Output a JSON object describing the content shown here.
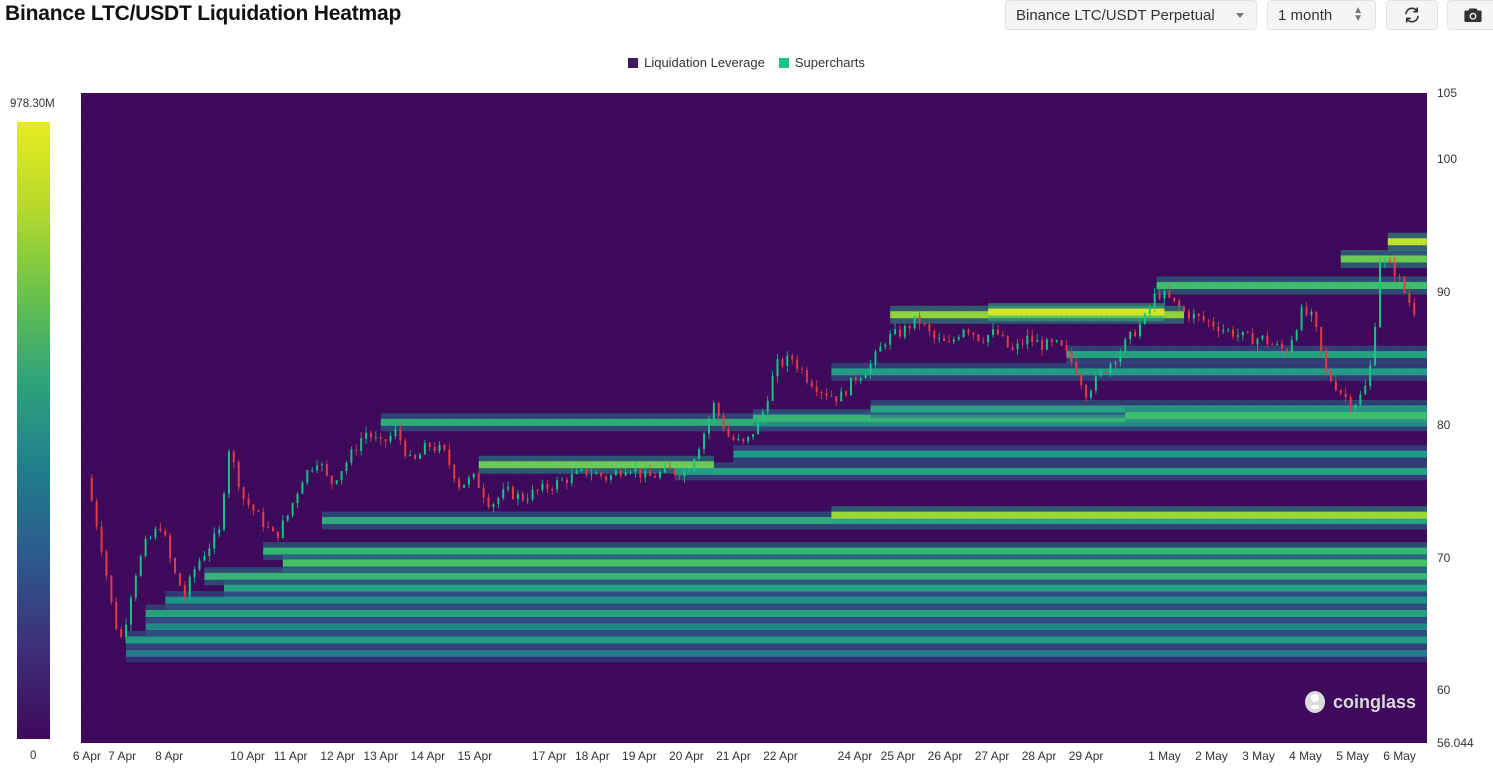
{
  "header": {
    "title": "Binance LTC/USDT Liquidation Heatmap",
    "exchange_select": "Binance LTC/USDT Perpetual",
    "period_select": "1 month"
  },
  "icons": {
    "refresh": "refresh-icon",
    "camera": "camera-icon",
    "watermark": "coinglass-logo-icon"
  },
  "watermark": "coinglass",
  "colorbar": {
    "max_label": "978.30M",
    "min_label": "0",
    "colors": [
      "#3e0a5b",
      "#2c5b8e",
      "#1f9a8a",
      "#3fbf6f",
      "#9ad93a",
      "#e7ec1e"
    ]
  },
  "chart_data": {
    "type": "heatmap",
    "title": "Binance LTC/USDT Liquidation Heatmap",
    "legend": [
      {
        "name": "Liquidation Leverage",
        "color": "#3e1a60"
      },
      {
        "name": "Supercharts",
        "color": "#16c784"
      }
    ],
    "legend_position": "top-center",
    "x_labels": [
      "6 Apr",
      "7 Apr",
      "8 Apr",
      "10 Apr",
      "11 Apr",
      "12 Apr",
      "13 Apr",
      "14 Apr",
      "15 Apr",
      "17 Apr",
      "18 Apr",
      "19 Apr",
      "20 Apr",
      "21 Apr",
      "22 Apr",
      "24 Apr",
      "25 Apr",
      "26 Apr",
      "27 Apr",
      "28 Apr",
      "29 Apr",
      "1 May",
      "2 May",
      "3 May",
      "4 May",
      "5 May",
      "6 May"
    ],
    "x_label_hours": [
      0,
      18,
      42,
      82,
      104,
      128,
      150,
      174,
      198,
      236,
      258,
      282,
      306,
      330,
      354,
      392,
      414,
      438,
      462,
      486,
      510,
      550,
      574,
      598,
      622,
      646,
      670
    ],
    "x_range_hours": [
      -3,
      684
    ],
    "y_range": [
      56.044,
      105
    ],
    "y_ticks": [
      105,
      100,
      90,
      80,
      70,
      60,
      56.044
    ],
    "y_axis_position": "right",
    "colorbar_range": [
      0,
      978300000
    ],
    "price_path": [
      [
        0,
        76.0
      ],
      [
        8,
        70.5
      ],
      [
        14,
        65.2
      ],
      [
        18,
        63.8
      ],
      [
        24,
        68.5
      ],
      [
        30,
        71.0
      ],
      [
        38,
        72.5
      ],
      [
        44,
        69.0
      ],
      [
        50,
        67.2
      ],
      [
        56,
        69.5
      ],
      [
        62,
        70.8
      ],
      [
        68,
        72.0
      ],
      [
        72,
        78.5
      ],
      [
        80,
        74.5
      ],
      [
        88,
        73.0
      ],
      [
        96,
        71.5
      ],
      [
        102,
        73.0
      ],
      [
        110,
        76.0
      ],
      [
        118,
        77.5
      ],
      [
        124,
        75.5
      ],
      [
        134,
        77.5
      ],
      [
        142,
        79.5
      ],
      [
        150,
        78.5
      ],
      [
        158,
        79.5
      ],
      [
        166,
        77.0
      ],
      [
        174,
        78.5
      ],
      [
        182,
        78.0
      ],
      [
        190,
        75.5
      ],
      [
        198,
        76.0
      ],
      [
        206,
        74.0
      ],
      [
        214,
        75.0
      ],
      [
        222,
        74.5
      ],
      [
        230,
        75.0
      ],
      [
        238,
        75.5
      ],
      [
        246,
        76.0
      ],
      [
        256,
        76.5
      ],
      [
        266,
        76.0
      ],
      [
        276,
        77.0
      ],
      [
        286,
        76.0
      ],
      [
        296,
        76.5
      ],
      [
        306,
        76.5
      ],
      [
        314,
        79.0
      ],
      [
        320,
        81.5
      ],
      [
        328,
        79.0
      ],
      [
        336,
        78.5
      ],
      [
        344,
        80.5
      ],
      [
        352,
        84.5
      ],
      [
        360,
        85.0
      ],
      [
        368,
        83.5
      ],
      [
        376,
        82.5
      ],
      [
        384,
        82.0
      ],
      [
        392,
        83.5
      ],
      [
        400,
        84.5
      ],
      [
        408,
        86.5
      ],
      [
        416,
        87.0
      ],
      [
        424,
        88.0
      ],
      [
        432,
        86.5
      ],
      [
        440,
        86.0
      ],
      [
        448,
        87.5
      ],
      [
        456,
        86.5
      ],
      [
        464,
        87.0
      ],
      [
        472,
        85.5
      ],
      [
        480,
        86.5
      ],
      [
        488,
        86.0
      ],
      [
        496,
        86.0
      ],
      [
        504,
        84.5
      ],
      [
        510,
        82.5
      ],
      [
        516,
        83.5
      ],
      [
        524,
        85.0
      ],
      [
        532,
        86.5
      ],
      [
        540,
        88.0
      ],
      [
        546,
        90.0
      ],
      [
        552,
        89.5
      ],
      [
        560,
        88.5
      ],
      [
        568,
        88.0
      ],
      [
        576,
        87.5
      ],
      [
        584,
        87.0
      ],
      [
        592,
        86.5
      ],
      [
        600,
        86.5
      ],
      [
        606,
        86.0
      ],
      [
        612,
        85.5
      ],
      [
        620,
        88.5
      ],
      [
        626,
        88.0
      ],
      [
        632,
        84.0
      ],
      [
        640,
        82.5
      ],
      [
        646,
        81.5
      ],
      [
        652,
        82.5
      ],
      [
        656,
        85.0
      ],
      [
        660,
        92.5
      ],
      [
        668,
        91.5
      ],
      [
        674,
        89.5
      ],
      [
        678,
        88.5
      ]
    ],
    "liquidation_bands": [
      {
        "start": 120,
        "end": 684,
        "price": 72.8,
        "intensity": 0.5
      },
      {
        "start": 380,
        "end": 684,
        "price": 73.2,
        "intensity": 0.8
      },
      {
        "start": 90,
        "end": 684,
        "price": 70.5,
        "intensity": 0.55
      },
      {
        "start": 100,
        "end": 684,
        "price": 69.6,
        "intensity": 0.62
      },
      {
        "start": 60,
        "end": 684,
        "price": 68.6,
        "intensity": 0.55
      },
      {
        "start": 70,
        "end": 684,
        "price": 67.7,
        "intensity": 0.45
      },
      {
        "start": 40,
        "end": 684,
        "price": 66.8,
        "intensity": 0.38
      },
      {
        "start": 30,
        "end": 684,
        "price": 65.8,
        "intensity": 0.45
      },
      {
        "start": 30,
        "end": 684,
        "price": 64.8,
        "intensity": 0.35
      },
      {
        "start": 20,
        "end": 684,
        "price": 63.8,
        "intensity": 0.42
      },
      {
        "start": 20,
        "end": 684,
        "price": 62.8,
        "intensity": 0.3
      },
      {
        "start": 300,
        "end": 684,
        "price": 76.5,
        "intensity": 0.45
      },
      {
        "start": 330,
        "end": 684,
        "price": 77.8,
        "intensity": 0.4
      },
      {
        "start": 200,
        "end": 320,
        "price": 77.0,
        "intensity": 0.7
      },
      {
        "start": 150,
        "end": 684,
        "price": 80.2,
        "intensity": 0.5
      },
      {
        "start": 340,
        "end": 684,
        "price": 80.5,
        "intensity": 0.55
      },
      {
        "start": 400,
        "end": 684,
        "price": 81.2,
        "intensity": 0.45
      },
      {
        "start": 530,
        "end": 684,
        "price": 80.7,
        "intensity": 0.6
      },
      {
        "start": 380,
        "end": 684,
        "price": 84.0,
        "intensity": 0.42
      },
      {
        "start": 500,
        "end": 684,
        "price": 85.3,
        "intensity": 0.45
      },
      {
        "start": 410,
        "end": 560,
        "price": 88.3,
        "intensity": 0.78
      },
      {
        "start": 460,
        "end": 550,
        "price": 88.5,
        "intensity": 0.95
      },
      {
        "start": 546,
        "end": 684,
        "price": 90.5,
        "intensity": 0.6
      },
      {
        "start": 640,
        "end": 684,
        "price": 92.5,
        "intensity": 0.7
      },
      {
        "start": 664,
        "end": 684,
        "price": 93.8,
        "intensity": 0.9
      }
    ]
  },
  "caption": ""
}
